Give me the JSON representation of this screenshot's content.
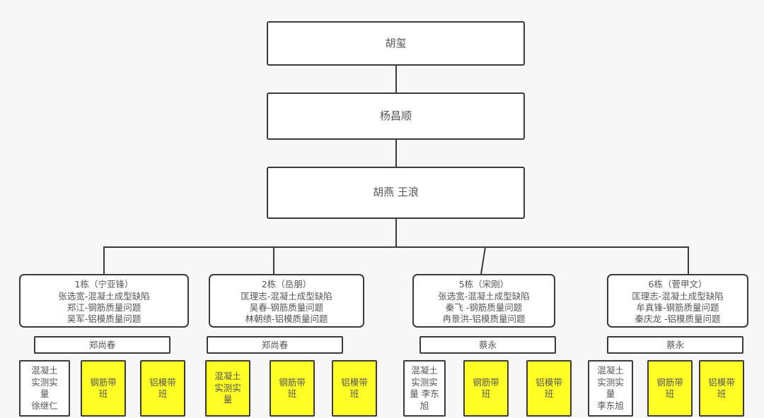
{
  "chart": {
    "type": "org-chart",
    "background_color": "#f7f7f7",
    "border_color": "#3a3a3a",
    "text_color": "#555555",
    "highlight_color": "#ffff26"
  },
  "levels": {
    "level1": {
      "label": "胡玺"
    },
    "level2": {
      "label": "杨昌顺"
    },
    "level3": {
      "label": "胡燕  王浪"
    }
  },
  "departments": [
    {
      "title": "1栋（宁亚锋）",
      "lines": [
        "张选宽-混凝土成型缺陷",
        "郑江-钢筋质量问题",
        "吴军-铝模质量问题"
      ],
      "supervisor": "郑尚春",
      "tiles": [
        {
          "lines": [
            "混凝土",
            "实测实",
            "量",
            "徐继仁"
          ],
          "highlighted": false
        },
        {
          "lines": [
            "钢筋带",
            "班"
          ],
          "highlighted": true
        },
        {
          "lines": [
            "铝模带",
            "班"
          ],
          "highlighted": true
        }
      ]
    },
    {
      "title": "2栋（岳朋）",
      "lines": [
        "匡理志-混凝土成型缺陷",
        "吴春-钢筋质量问题",
        "林朝绩-铝模质量问题"
      ],
      "supervisor": "郑尚春",
      "tiles": [
        {
          "lines": [
            "混凝土",
            "实测实",
            "量"
          ],
          "highlighted": true
        },
        {
          "lines": [
            "钢筋带",
            "班"
          ],
          "highlighted": true
        },
        {
          "lines": [
            "铝模带",
            "班"
          ],
          "highlighted": true
        }
      ]
    },
    {
      "title": "5栋（宋刚）",
      "lines": [
        "张选宽-混凝土成型缺陷",
        "秦飞 -钢筋质量问题",
        "冉景洪-铝模质量问题"
      ],
      "supervisor": "蔡永",
      "tiles": [
        {
          "lines": [
            "混凝土",
            "实测实",
            "量 李东",
            "旭"
          ],
          "highlighted": false
        },
        {
          "lines": [
            "钢筋带",
            "班"
          ],
          "highlighted": true
        },
        {
          "lines": [
            "铝模带",
            "班"
          ],
          "highlighted": true
        }
      ]
    },
    {
      "title": "6栋（菅甲文）",
      "lines": [
        "匡理志-混凝土成型缺陷",
        "牟真锋-钢筋质量问题",
        "秦庆龙 -铝模质量问题"
      ],
      "supervisor": "蔡永",
      "tiles": [
        {
          "lines": [
            "混凝土",
            "实测实",
            "量",
            "李东旭"
          ],
          "highlighted": false
        },
        {
          "lines": [
            "钢筋带",
            "班"
          ],
          "highlighted": true
        },
        {
          "lines": [
            "铝模带",
            "班"
          ],
          "highlighted": true
        }
      ]
    }
  ]
}
